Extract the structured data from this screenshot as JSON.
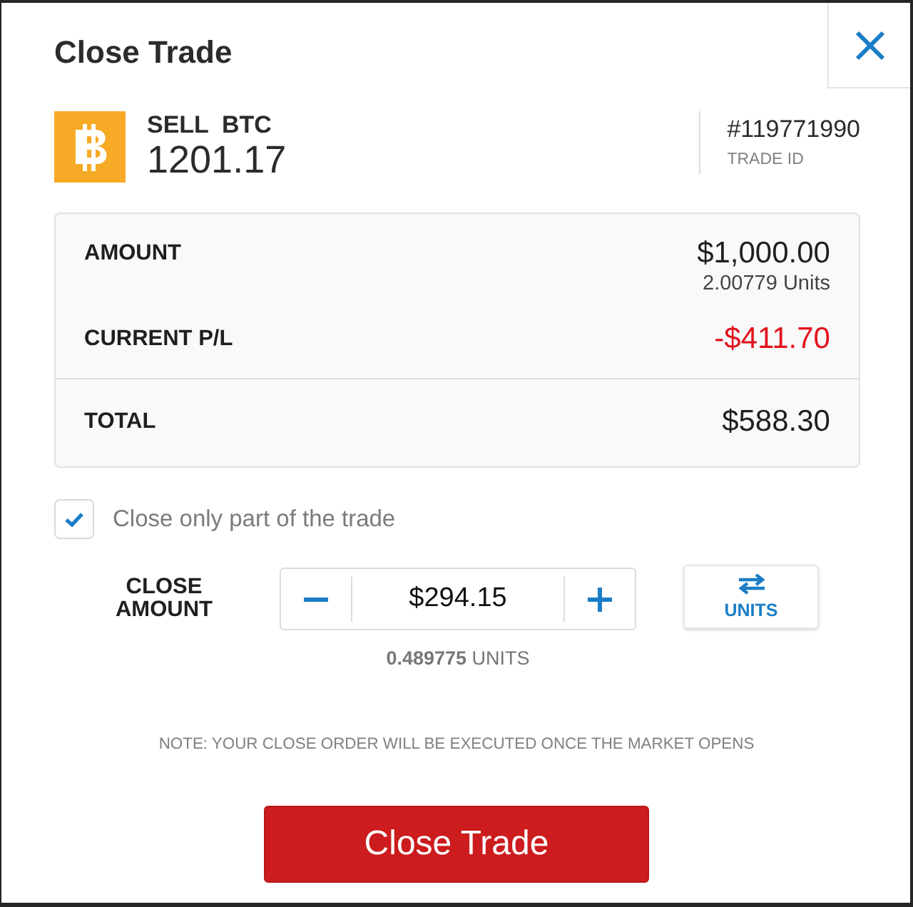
{
  "dialog": {
    "title": "Close Trade"
  },
  "trade": {
    "side": "SELL",
    "symbol": "BTC",
    "price": "1201.17",
    "trade_id": "#119771990",
    "trade_id_label": "TRADE ID"
  },
  "summary": {
    "rows": [
      {
        "kind": "amount",
        "label": "AMOUNT",
        "value": "$1,000.00",
        "sub_value": "2.00779 Units",
        "negative": false
      },
      {
        "kind": "pl",
        "label": "CURRENT P/L",
        "value": "-$411.70",
        "negative": true
      }
    ],
    "total": {
      "label": "TOTAL",
      "value": "$588.30"
    }
  },
  "partial_close": {
    "label": "Close only part of the trade",
    "checked": true
  },
  "close_amount": {
    "label": "CLOSE AMOUNT",
    "value": "$294.15",
    "units_reading": "**0.489775** UNITS",
    "toggle_label": "UNITS"
  },
  "note": "NOTE: YOUR CLOSE ORDER WILL BE EXECUTED ONCE THE MARKET OPENS",
  "submit_button": "Close Trade"
}
